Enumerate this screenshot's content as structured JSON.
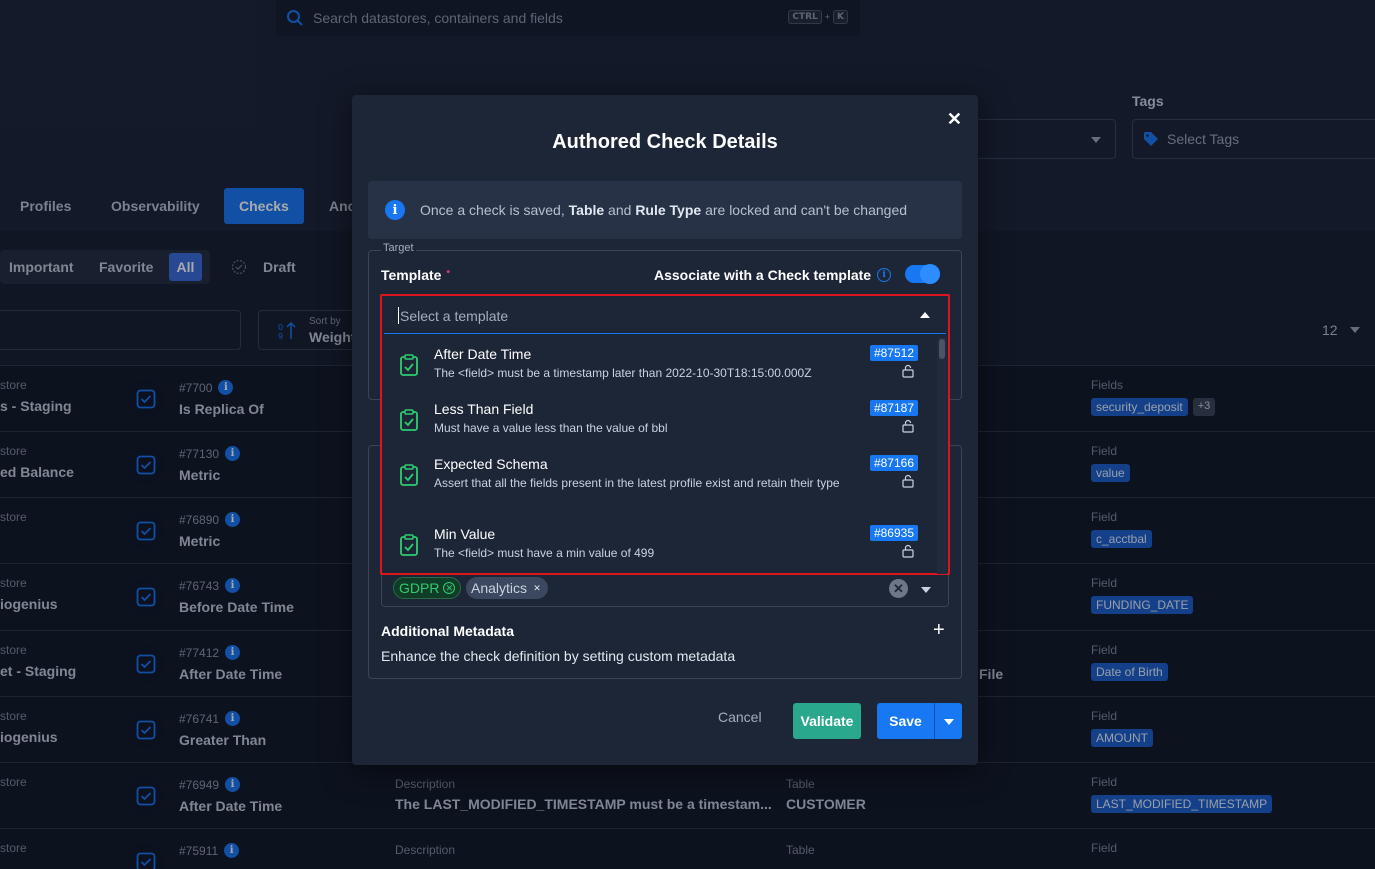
{
  "search": {
    "placeholder": "Search datastores, containers and fields",
    "shortcut_key1": "CTRL",
    "shortcut_plus": "+",
    "shortcut_key2": "K"
  },
  "filters": {
    "tags_label": "Tags",
    "tags_placeholder": "Select Tags"
  },
  "tabs": [
    {
      "label": "Profiles"
    },
    {
      "label": "Observability"
    },
    {
      "label": "Checks"
    },
    {
      "label": "Anc"
    }
  ],
  "status_filters": {
    "important": "Important",
    "favorite": "Favorite",
    "all": "All",
    "draft": "Draft"
  },
  "sort": {
    "label": "Sort by",
    "value": "Weight"
  },
  "pager": {
    "count": "12"
  },
  "rows": [
    {
      "store_label": "store",
      "store": "s - Staging",
      "id": "#7700",
      "name": "Is Replica Of",
      "field_label": "Fields",
      "field": "security_deposit",
      "extra": "+3"
    },
    {
      "store_label": "store",
      "store": "ed Balance",
      "id": "#77130",
      "name": "Metric",
      "field_label": "Field",
      "field": "value"
    },
    {
      "store_label": "store",
      "store": "",
      "id": "#76890",
      "name": "Metric",
      "field_label": "Field",
      "field": "c_acctbal"
    },
    {
      "store_label": "store",
      "store": "iogenius",
      "id": "#76743",
      "name": "Before Date Time",
      "field_label": "Field",
      "field": "FUNDING_DATE"
    },
    {
      "store_label": "store",
      "store": "et - Staging",
      "id": "#77412",
      "name": "After Date Time",
      "field_label": "Field",
      "field": "Date of Birth",
      "side_text": "File"
    },
    {
      "store_label": "store",
      "store": "iogenius",
      "id": "#76741",
      "name": "Greater Than",
      "field_label": "Field",
      "field": "AMOUNT"
    },
    {
      "store_label": "store",
      "store": "",
      "id": "#76949",
      "name": "After Date Time",
      "desc_label": "Description",
      "desc": "The LAST_MODIFIED_TIMESTAMP must be a timestam...",
      "table_label": "Table",
      "table": "CUSTOMER",
      "field_label": "Field",
      "field": "LAST_MODIFIED_TIMESTAMP"
    },
    {
      "store_label": "store",
      "store": "",
      "id": "#75911",
      "name": "",
      "desc_label": "Description",
      "table_label": "Table",
      "field_label": "Field",
      "field": ""
    }
  ],
  "modal": {
    "title": "Authored Check Details",
    "notice_pre": "Once a check is saved, ",
    "notice_b1": "Table",
    "notice_mid": " and ",
    "notice_b2": "Rule Type",
    "notice_post": " are locked and can't be changed",
    "fieldset_legend": "Target",
    "template_label": "Template",
    "required_mark": "•",
    "associate_label": "Associate with a Check template",
    "associate_on": true,
    "template_placeholder": "Select a template",
    "options": [
      {
        "title": "After Date Time",
        "desc": "The <field> must be a timestamp later than 2022-10-30T18:15:00.000Z",
        "id": "#87512"
      },
      {
        "title": "Less Than Field",
        "desc": "Must have a value less than the value of bbl",
        "id": "#87187"
      },
      {
        "title": "Expected Schema",
        "desc": "Assert that all the fields present in the latest profile exist and retain their type",
        "id": "#87166"
      },
      {
        "title": "Min Value",
        "desc": "The <field> must have a min value of 499",
        "id": "#86935"
      }
    ],
    "tags": [
      {
        "label": "GDPR",
        "color": "#2ecc71"
      },
      {
        "label": "Analytics",
        "color": "#c9d2e0"
      }
    ],
    "additional_metadata_label": "Additional Metadata",
    "additional_metadata_desc": "Enhance the check definition by setting custom metadata",
    "cancel": "Cancel",
    "validate": "Validate",
    "save": "Save"
  },
  "colors": {
    "accent": "#1877f2",
    "validate": "#2aa88e",
    "highlight": "#e0141e"
  }
}
